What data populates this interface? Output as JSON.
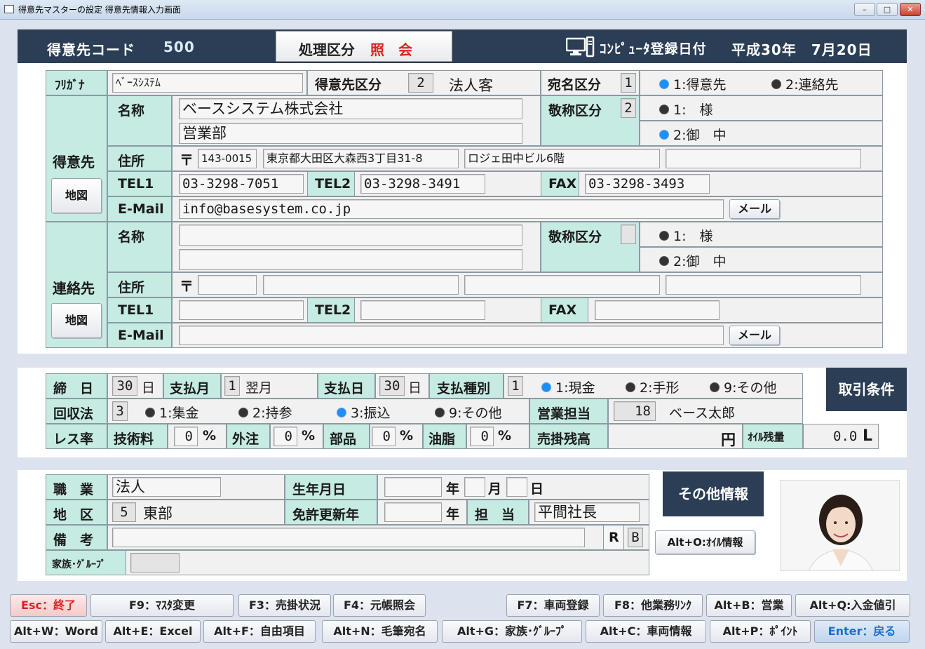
{
  "window": {
    "title": "得意先マスターの設定 得意先情報入力画面"
  },
  "header": {
    "code_label": "得意先コード",
    "code_value": "500",
    "mode_label": "処理区分",
    "mode_value": "照　会",
    "reg_label": "ｺﾝﾋﾟｭｰﾀ登録日付",
    "reg_date": "平成30年　7月20日"
  },
  "customer": {
    "furigana_label": "ﾌﾘｶﾞﾅ",
    "furigana": "ﾍﾞｰｽｼｽﾃﾑ",
    "kubun_label": "得意先区分",
    "kubun_code": "2",
    "kubun_name": "法人客",
    "atena_label": "宛名区分",
    "atena_code": "1",
    "atena_opt1": "1:得意先",
    "atena_opt2": "2:連絡先",
    "section_label": "得意先",
    "map_button": "地図",
    "name_label": "名称",
    "name1": "ベースシステム株式会社",
    "name2": "営業部",
    "keisho_label": "敬称区分",
    "keisho_code": "2",
    "keisho_opt1": "1:　様",
    "keisho_opt2": "2:御　中",
    "addr_label": "住所",
    "zip_mark": "〒",
    "zip": "143-0015",
    "addr1": "東京都大田区大森西3丁目31-8",
    "addr2": "ロジェ田中ビル6階",
    "addr3": "",
    "tel1_label": "TEL1",
    "tel1": "03-3298-7051",
    "tel2_label": "TEL2",
    "tel2": "03-3298-3491",
    "fax_label": "FAX",
    "fax": "03-3298-3493",
    "email_label": "E-Mail",
    "email": "info@basesystem.co.jp",
    "mail_button": "メール"
  },
  "contact": {
    "section_label": "連絡先",
    "map_button": "地図",
    "name_label": "名称",
    "name1": "",
    "name2": "",
    "keisho_label": "敬称区分",
    "keisho_code": "",
    "keisho_opt1": "1:　様",
    "keisho_opt2": "2:御　中",
    "addr_label": "住所",
    "zip_mark": "〒",
    "zip": "",
    "addr1": "",
    "addr2": "",
    "addr3": "",
    "tel1_label": "TEL1",
    "tel1": "",
    "tel2_label": "TEL2",
    "tel2": "",
    "fax_label": "FAX",
    "fax": "",
    "email_label": "E-Mail",
    "email": "",
    "mail_button": "メール"
  },
  "terms": {
    "title": "取引条件",
    "shime_label": "締　日",
    "shime": "30",
    "day_unit": "日",
    "paymonth_label": "支払月",
    "paymonth_code": "1",
    "paymonth_name": "翌月",
    "payday_label": "支払日",
    "payday": "30",
    "paytype_label": "支払種別",
    "paytype_code": "1",
    "paytype_opt1": "1:現金",
    "paytype_opt2": "2:手形",
    "paytype_opt3": "9:その他",
    "collect_label": "回収法",
    "collect_code": "3",
    "collect_opt1": "1:集金",
    "collect_opt2": "2:持参",
    "collect_opt3": "3:振込",
    "collect_opt4": "9:その他",
    "sales_label": "営業担当",
    "sales_code": "18",
    "sales_name": "ベース太郎",
    "rate_label": "レス率",
    "tech_label": "技術料",
    "tech": "0",
    "outs_label": "外注",
    "outs": "0",
    "parts_label": "部品",
    "parts": "0",
    "oil_label": "油脂",
    "oil": "0",
    "pct": "%",
    "balance_label": "売掛残高",
    "balance": "",
    "yen": "円",
    "oil_rem_label": "ｵｲﾙ残量",
    "oil_rem": "0.0",
    "liter": "L"
  },
  "other": {
    "title": "その他情報",
    "job_label": "職　業",
    "job": "法人",
    "birth_label": "生年月日",
    "year_unit": "年",
    "month_unit": "月",
    "day_unit": "日",
    "area_label": "地　区",
    "area_code": "5",
    "area_name": "東部",
    "license_label": "免許更新年",
    "license_year_unit": "年",
    "tanto_label": "担　当",
    "tanto": "平間社長",
    "note_label": "備　考",
    "r_label": "R",
    "b_label": "B",
    "family_label": "家族･ｸﾞﾙｰﾌﾟ",
    "oil_button": "Alt+O:ｵｲﾙ情報"
  },
  "fkeys": {
    "row1": [
      "Esc：終了",
      "F9：ﾏｽﾀ変更",
      "F3：売掛状況",
      "F4：元帳照会",
      "F7：車両登録",
      "F8：他業務ﾘﾝｸ",
      "Alt+B：営業",
      "Alt+Q:入金値引"
    ],
    "row2": [
      "Alt+W：Word",
      "Alt+E：Excel",
      "Alt+F：自由項目",
      "Alt+N：毛筆宛名",
      "Alt+G：家族･ｸﾞﾙｰﾌﾟ",
      "Alt+C：車両情報",
      "Alt+P：ﾎﾟｲﾝﾄ",
      "Enter：戻る"
    ]
  },
  "colors": {
    "navy": "#2b3e55",
    "teal": "#c6ebe2",
    "accent_red": "#e02020",
    "accent_blue": "#1a6fd0"
  }
}
